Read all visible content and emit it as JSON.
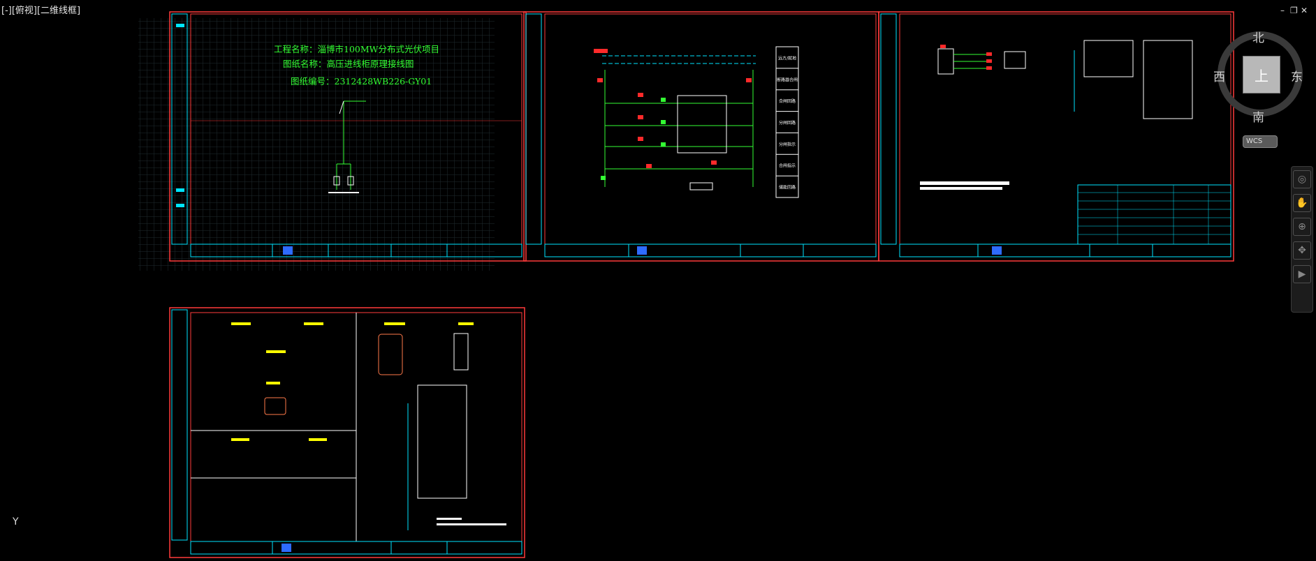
{
  "viewport": {
    "label": "[-][俯视][二维线框]"
  },
  "window_controls": {
    "minimize": "–",
    "restore": "❐",
    "close": "✕"
  },
  "viewcube": {
    "north": "北",
    "south": "南",
    "east": "东",
    "west": "西",
    "face": "上",
    "wcs": "WCS"
  },
  "navbar": {
    "icons": [
      "steering-wheel-icon",
      "pan-icon",
      "zoom-icon",
      "orbit-icon",
      "showmotion-icon"
    ]
  },
  "ucs": {
    "y_axis": "Y"
  },
  "sheet1": {
    "project_name": "工程名称：淄博市100MW分布式光伏项目",
    "drawing_name": "图纸名称：高压进线柜原理接线图",
    "drawing_number": "图纸编号：2312428WB226-GY01"
  },
  "sheet2": {
    "labels": [
      "远方/就地",
      "断路器合闸",
      "合闸回路",
      "分闸回路",
      "分闸指示",
      "合闸指示",
      "储能回路"
    ]
  },
  "colors": {
    "frame": "#ff3b3b",
    "cyan": "#00e5ff",
    "green": "#33ff33",
    "yellow": "#ffff00",
    "white": "#ffffff",
    "grid": "#1e2a2e",
    "red": "#ff2a2a"
  }
}
